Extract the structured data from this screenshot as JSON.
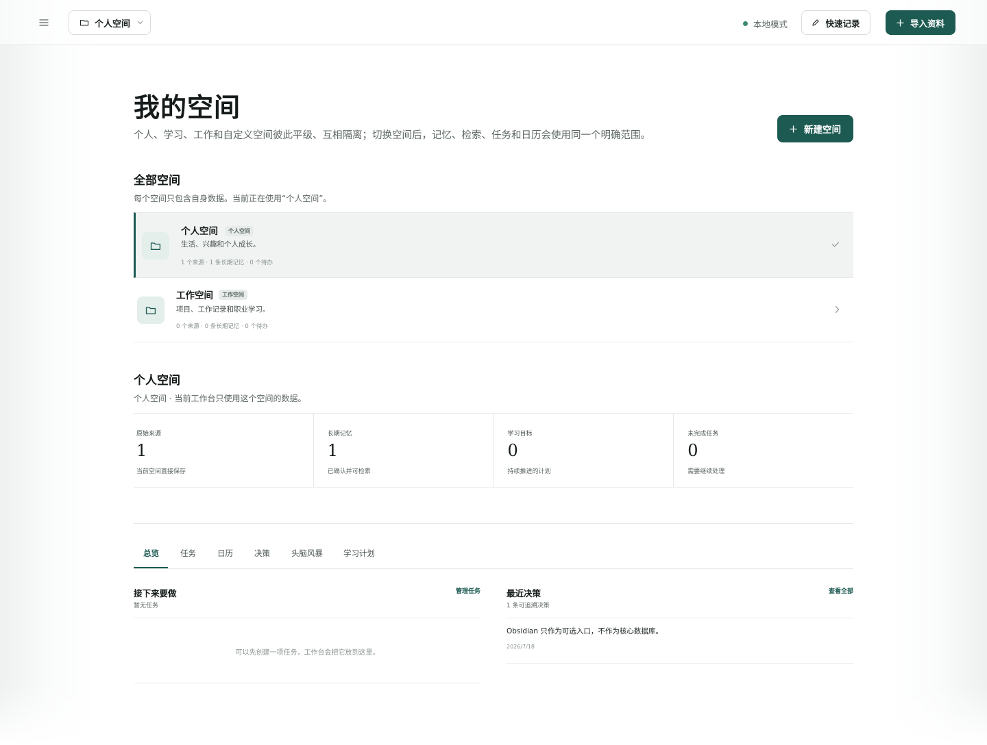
{
  "topbar": {
    "current_space": "个人空间",
    "mode_label": "本地模式",
    "quick_record": "快速记录",
    "import": "导入资料"
  },
  "header": {
    "title": "我的空间",
    "description": "个人、学习、工作和自定义空间彼此平级、互相隔离；切换空间后，记忆、检索、任务和日历会使用同一个明确范围。",
    "new_space": "新建空间"
  },
  "all_spaces": {
    "title": "全部空间",
    "subtitle": "每个空间只包含自身数据。当前正在使用“个人空间”。",
    "items": [
      {
        "name": "个人空间",
        "tag": "个人空间",
        "description": "生活、兴趣和个人成长。",
        "meta": "1 个来源 · 1 条长期记忆 · 0 个待办",
        "active": true
      },
      {
        "name": "工作空间",
        "tag": "工作空间",
        "description": "项目、工作记录和职业学习。",
        "meta": "0 个来源 · 0 条长期记忆 · 0 个待办",
        "active": false
      }
    ]
  },
  "current_space": {
    "title": "个人空间",
    "subtitle": "个人空间 · 当前工作台只使用这个空间的数据。",
    "stats": [
      {
        "label": "原始来源",
        "value": "1",
        "note": "当前空间直接保存"
      },
      {
        "label": "长期记忆",
        "value": "1",
        "note": "已确认并可检索"
      },
      {
        "label": "学习目标",
        "value": "0",
        "note": "持续推进的计划"
      },
      {
        "label": "未完成任务",
        "value": "0",
        "note": "需要继续处理"
      }
    ]
  },
  "tabs": [
    "总览",
    "任务",
    "日历",
    "决策",
    "头脑风暴",
    "学习计划"
  ],
  "active_tab": "总览",
  "next_up": {
    "title": "接下来要做",
    "subtitle": "暂无任务",
    "link": "管理任务",
    "empty": "可以先创建一项任务，工作台会把它放到这里。"
  },
  "decisions": {
    "title": "最近决策",
    "subtitle": "1 条可追溯决策",
    "link": "查看全部",
    "items": [
      {
        "text": "Obsidian 只作为可选入口，不作为核心数据库。",
        "date": "2026/7/18"
      }
    ]
  },
  "colors": {
    "accent": "#1c5a52",
    "status_dot": "#3a8a6c"
  }
}
